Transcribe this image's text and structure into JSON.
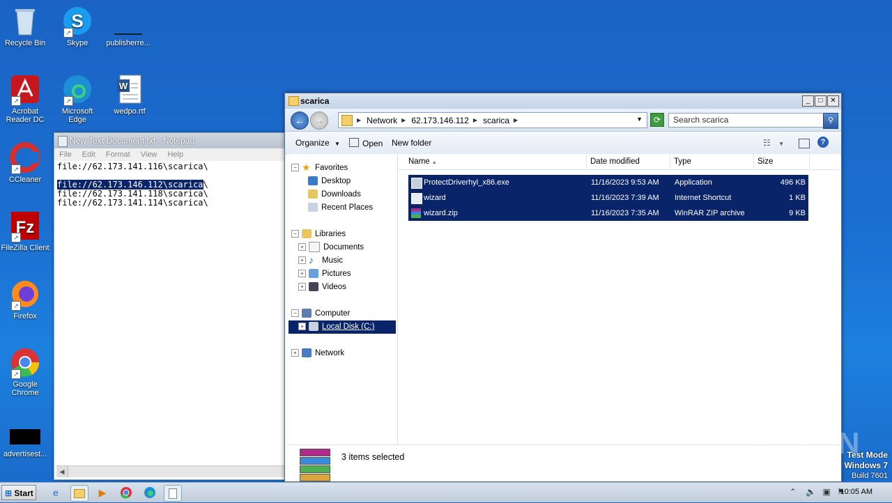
{
  "desktop": {
    "icons": [
      {
        "label": "Recycle Bin",
        "icon": "recycle-bin-icon"
      },
      {
        "label": "Skype",
        "icon": "skype-icon"
      },
      {
        "label": "publisherre...",
        "icon": "file-icon"
      },
      {
        "label": "Acrobat Reader DC",
        "icon": "acrobat-icon"
      },
      {
        "label": "Microsoft Edge",
        "icon": "edge-icon"
      },
      {
        "label": "wedpo.rtf",
        "icon": "word-document-icon"
      },
      {
        "label": "CCleaner",
        "icon": "ccleaner-icon"
      },
      {
        "label": "FileZilla Client",
        "icon": "filezilla-icon"
      },
      {
        "label": "Firefox",
        "icon": "firefox-icon"
      },
      {
        "label": "Google Chrome",
        "icon": "chrome-icon"
      },
      {
        "label": "advertisest...",
        "icon": "file-icon"
      }
    ]
  },
  "notepad": {
    "title": "New Text Document.txt - Notepad",
    "menu": [
      "File",
      "Edit",
      "Format",
      "View",
      "Help"
    ],
    "lines": [
      "file://62.173.141.116\\scarica\\",
      "",
      "file://62.173.146.112\\scarica",
      "\\",
      "file://62.173.141.118\\scarica\\",
      "file://62.173.141.114\\scarica\\"
    ]
  },
  "explorer": {
    "title": "scarica",
    "breadcrumb": [
      "Network",
      "62.173.146.112",
      "scarica"
    ],
    "search_placeholder": "Search scarica",
    "toolbar": {
      "organize": "Organize",
      "open": "Open",
      "new_folder": "New folder"
    },
    "nav": {
      "favorites": "Favorites",
      "desktop": "Desktop",
      "downloads": "Downloads",
      "recent": "Recent Places",
      "libraries": "Libraries",
      "documents": "Documents",
      "music": "Music",
      "pictures": "Pictures",
      "videos": "Videos",
      "computer": "Computer",
      "local_disk": "Local Disk (C:)",
      "network": "Network"
    },
    "columns": [
      "Name",
      "Date modified",
      "Type",
      "Size"
    ],
    "files": [
      {
        "name": "ProtectDriverhyl_x86.exe",
        "date": "11/16/2023 9:53 AM",
        "type": "Application",
        "size": "496 KB"
      },
      {
        "name": "wizard",
        "date": "11/16/2023 7:39 AM",
        "type": "Internet Shortcut",
        "size": "1 KB"
      },
      {
        "name": "wizard.zip",
        "date": "11/16/2023 7:35 AM",
        "type": "WinRAR ZIP archive",
        "size": "9 KB"
      }
    ],
    "details": "3 items selected"
  },
  "taskbar": {
    "start": "Start",
    "clock": "10:05 AM"
  },
  "watermark": {
    "line1": "Test Mode",
    "line2": "Windows 7",
    "line3": "Build 7601",
    "brand": "ANY RUN"
  },
  "colors": {
    "selection": "#0a246a",
    "desktop": "#1b6fd1"
  }
}
